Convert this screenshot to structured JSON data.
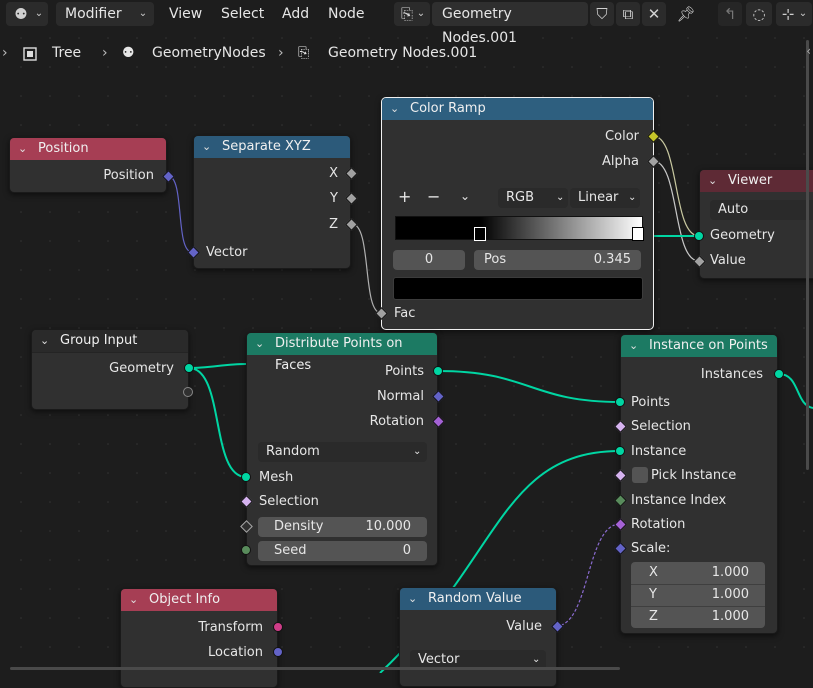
{
  "header": {
    "editor_type_icon": "node-editor-icon",
    "mode": "Modifier",
    "menus": [
      "View",
      "Select",
      "Add",
      "Node"
    ],
    "node_tree_name": "Geometry Nodes.001"
  },
  "breadcrumb": [
    "Tree",
    "GeometryNodes",
    "Geometry Nodes.001"
  ],
  "colors": {
    "header_input": "#a63e54",
    "header_vector": "#2c5a7a",
    "header_geometry": "#1c7a63",
    "header_output": "#5e2a35",
    "header_converter": "#2e5f7f",
    "socket_geometry": "#00d6a3",
    "socket_vector": "#6363c7",
    "socket_float": "#a1a1a1",
    "socket_color": "#c7c729",
    "socket_rotation": "#a562d6",
    "socket_int": "#598c5c",
    "socket_matrix": "#cf3d88"
  },
  "nodes": {
    "position": {
      "title": "Position",
      "out": "Position"
    },
    "separate_xyz": {
      "title": "Separate XYZ",
      "outs": [
        "X",
        "Y",
        "Z"
      ],
      "in": "Vector"
    },
    "color_ramp": {
      "title": "Color Ramp",
      "outs": [
        "Color",
        "Alpha"
      ],
      "color_mode": "RGB",
      "interpolation": "Linear",
      "stop_index": "0",
      "pos_label": "Pos",
      "pos_value": "0.345",
      "in": "Fac"
    },
    "viewer": {
      "title": "Viewer",
      "domain": "Auto",
      "ins": [
        "Geometry",
        "Value"
      ]
    },
    "group_input": {
      "title": "Group Input",
      "out": "Geometry"
    },
    "distribute": {
      "title": "Distribute Points on Faces",
      "outs": [
        "Points",
        "Normal",
        "Rotation"
      ],
      "mode": "Random",
      "ins": [
        "Mesh",
        "Selection"
      ],
      "density_label": "Density",
      "density_value": "10.000",
      "seed_label": "Seed",
      "seed_value": "0"
    },
    "instance_on_points": {
      "title": "Instance on Points",
      "out": "Instances",
      "ins": [
        "Points",
        "Selection",
        "Instance",
        "Pick Instance",
        "Instance Index",
        "Rotation",
        "Scale:"
      ],
      "scale": [
        {
          "axis": "X",
          "value": "1.000"
        },
        {
          "axis": "Y",
          "value": "1.000"
        },
        {
          "axis": "Z",
          "value": "1.000"
        }
      ]
    },
    "object_info": {
      "title": "Object Info",
      "outs": [
        "Transform",
        "Location"
      ]
    },
    "random_value": {
      "title": "Random Value",
      "out": "Value",
      "type": "Vector"
    }
  }
}
